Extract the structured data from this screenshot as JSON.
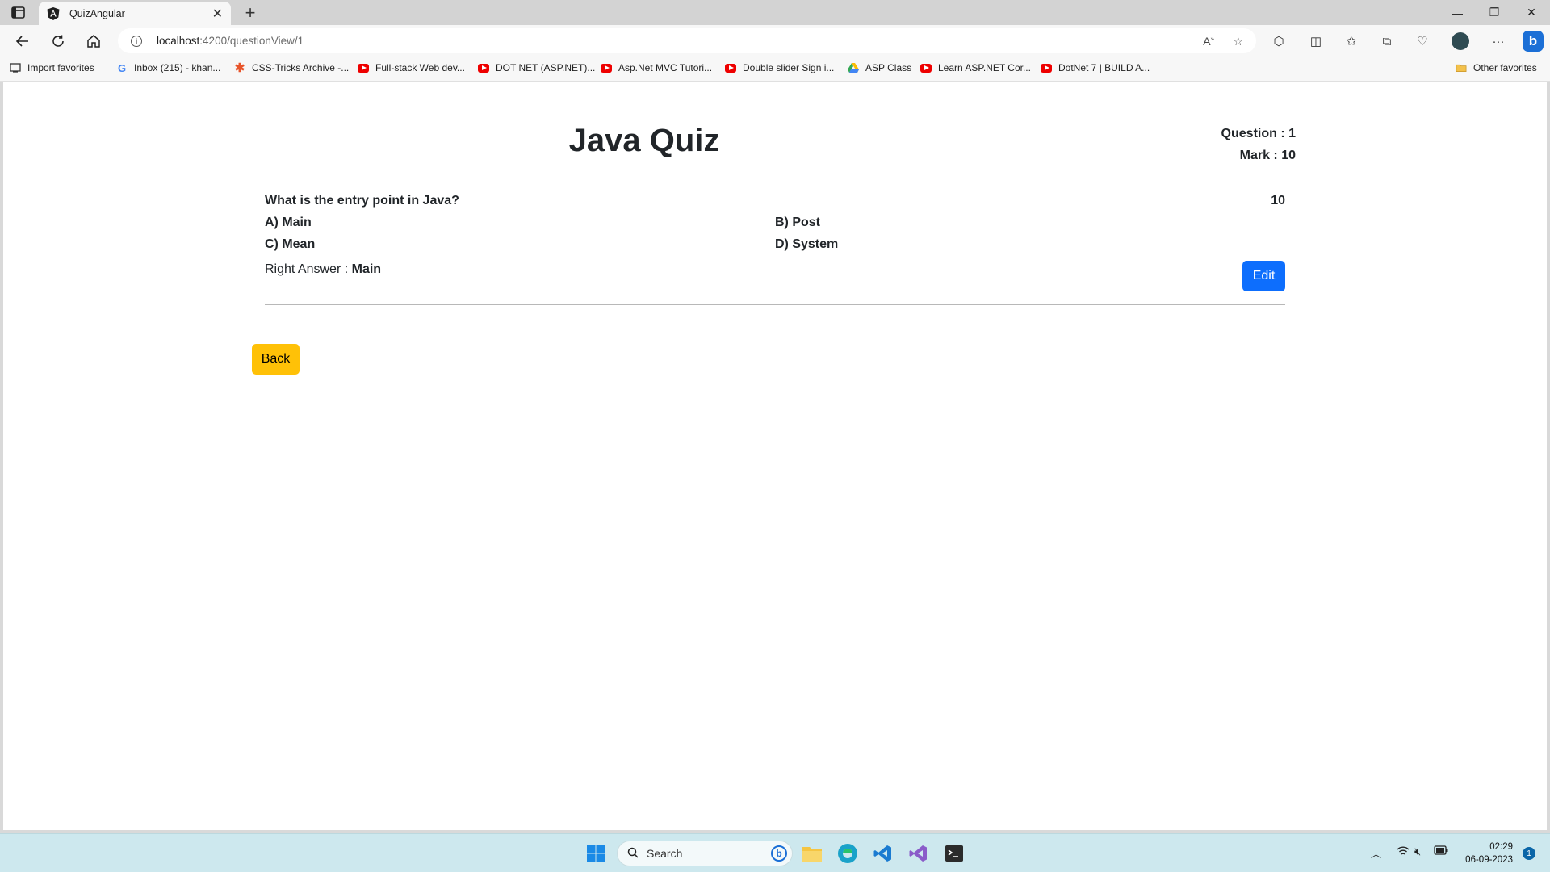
{
  "browser": {
    "tab_title": "QuizAngular",
    "url_host": "localhost",
    "url_rest": ":4200/questionView/1",
    "favorites": [
      {
        "label": "Import favorites",
        "icon": "import-icon"
      },
      {
        "label": "Inbox (215) - khan...",
        "icon": "google-icon"
      },
      {
        "label": "CSS-Tricks Archive -...",
        "icon": "css-tricks-icon"
      },
      {
        "label": "Full-stack Web dev...",
        "icon": "youtube-icon"
      },
      {
        "label": "DOT NET (ASP.NET)...",
        "icon": "youtube-icon"
      },
      {
        "label": "Asp.Net MVC Tutori...",
        "icon": "youtube-icon"
      },
      {
        "label": "Double slider Sign i...",
        "icon": "youtube-icon"
      },
      {
        "label": "ASP Class",
        "icon": "google-drive-icon"
      },
      {
        "label": "Learn ASP.NET Cor...",
        "icon": "youtube-icon"
      },
      {
        "label": "DotNet 7 | BUILD A...",
        "icon": "youtube-icon"
      }
    ],
    "other_favorites": "Other favorites"
  },
  "quiz": {
    "title": "Java Quiz",
    "question_label": "Question : 1",
    "mark_label": "Mark : 10",
    "question_text": "What is the entry point in Java?",
    "question_mark": "10",
    "options": {
      "a": "A) Main",
      "b": "B) Post",
      "c": "C) Mean",
      "d": "D) System"
    },
    "right_answer_label": "Right Answer : ",
    "right_answer_value": "Main",
    "edit_label": "Edit",
    "back_label": "Back"
  },
  "taskbar": {
    "search_label": "Search",
    "time": "02:29",
    "date": "06-09-2023",
    "notification_count": "1"
  },
  "colors": {
    "primary": "#0d6efd",
    "warning": "#ffc107",
    "taskbar": "#cde8ee"
  }
}
